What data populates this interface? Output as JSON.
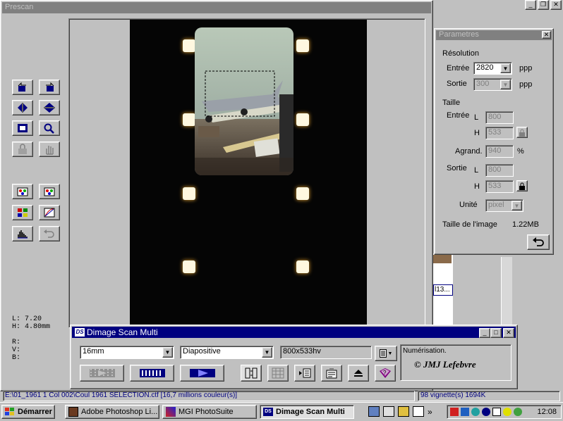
{
  "prescan": {
    "title": "Prescan",
    "readout": {
      "l": "L: 7.20",
      "h": "H: 4.80mm",
      "r": "R:",
      "v": "V:",
      "b": "B:"
    }
  },
  "params": {
    "title": "Parametres",
    "resolution": "Résolution",
    "entree_label": "Entrée",
    "entree_value": "2820",
    "ppp1": "ppp",
    "sortie_label": "Sortie",
    "sortie_value": "300",
    "ppp2": "ppp",
    "taille": "Taille",
    "taille_entree": "Entrée",
    "l1": "L",
    "l1_value": "800",
    "h1": "H",
    "h1_value": "533",
    "agrand": "Agrand.",
    "agrand_value": "940",
    "pct": "%",
    "taille_sortie": "Sortie",
    "l2": "L",
    "l2_value": "800",
    "h2": "H",
    "h2_value": "533",
    "unite": "Unité",
    "unite_value": "pixel",
    "taille_image": "Taille de l'image",
    "taille_image_value": "1.22MB"
  },
  "dimage": {
    "title": "Dimage Scan Multi",
    "film_format": "16mm",
    "film_type": "Diapositive",
    "size": "800x533hv",
    "status": "Numérisation.",
    "copyright": "© JMJ Lefebvre"
  },
  "bg": {
    "thumb_label": "l13..."
  },
  "statusbar": {
    "path": "E:\\01_1961 1 Col 002\\Coul 1961 SELECTION.ctf  [16,7 millions couleur(s)]",
    "vignettes": "98 vignette(s) 1694K"
  },
  "taskbar": {
    "start": "Démarrer",
    "tasks": [
      "Adobe Photoshop Li...",
      "MGI PhotoSuite",
      "Dimage Scan Multi"
    ],
    "overflow": "»",
    "clock": "12:08"
  },
  "photo": {
    "sign1": "",
    "sign2": ""
  }
}
